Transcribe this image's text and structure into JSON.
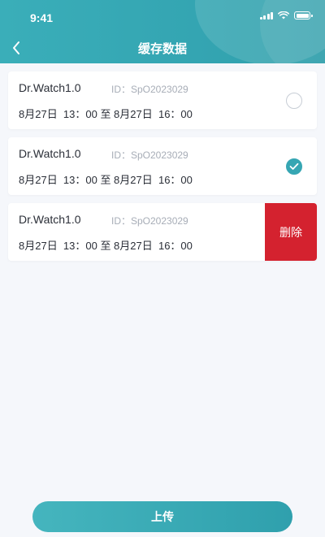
{
  "status_bar": {
    "time": "9:41",
    "icons": [
      "signal-icon",
      "wifi-icon",
      "battery-icon"
    ]
  },
  "nav": {
    "title": "缓存数据",
    "back_icon": "chevron-left-icon"
  },
  "records": [
    {
      "device": "Dr.Watch1.0",
      "id": "ID：SpO2023029",
      "range": "8月27日  13：00 至 8月27日  16：00",
      "selected": false
    },
    {
      "device": "Dr.Watch1.0",
      "id": "ID：SpO2023029",
      "range": "8月27日  13：00 至 8月27日  16：00",
      "selected": true
    },
    {
      "device": "Dr.Watch1.0",
      "id": "ID：SpO2023029",
      "range": "8月27日  13：00 至 8月27日  16：00",
      "delete_label": "删除"
    }
  ],
  "footer": {
    "upload_label": "上传"
  },
  "colors": {
    "accent": "#36a6b3",
    "danger": "#d4222f",
    "background": "#f5f7fb"
  }
}
